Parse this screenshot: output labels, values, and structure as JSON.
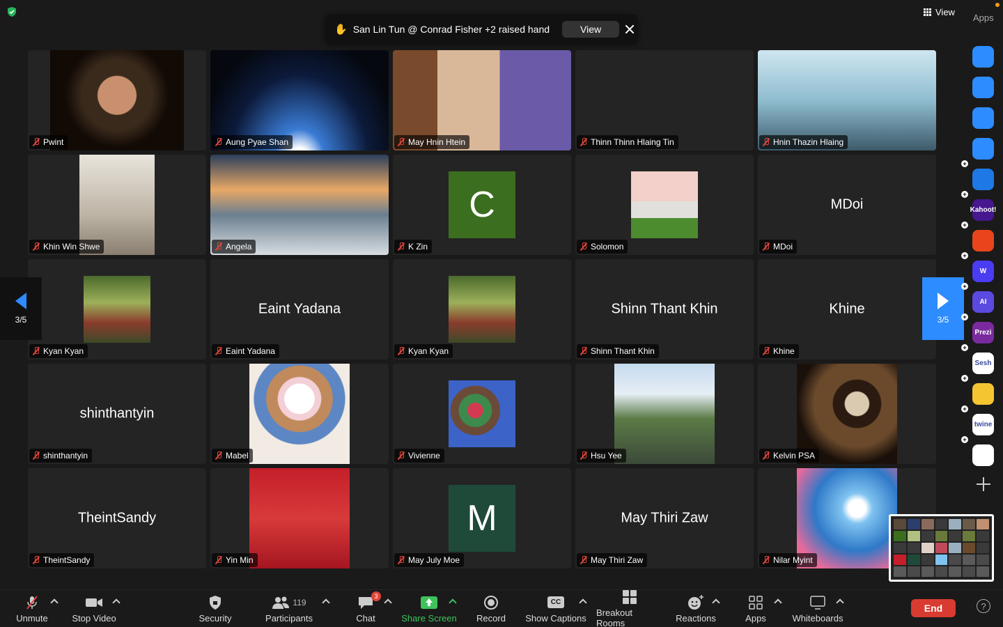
{
  "topbar": {
    "view_label": "View",
    "apps_title": "Apps"
  },
  "notification": {
    "message": "San Lin Tun @ Conrad Fisher +2 raised hand",
    "view_label": "View"
  },
  "pager": {
    "left_label": "3/5",
    "right_label": "3/5"
  },
  "participants": [
    {
      "name": "Pwint",
      "display": "video"
    },
    {
      "name": "Aung Pyae Shan",
      "display": "video"
    },
    {
      "name": "May Hnin Htein",
      "display": "video"
    },
    {
      "name": "Thinn Thinn Hlaing Tin",
      "display": "blank"
    },
    {
      "name": "Hnin Thazin Hlaing",
      "display": "video"
    },
    {
      "name": "Khin Win Shwe",
      "display": "video"
    },
    {
      "name": "Angela",
      "display": "video"
    },
    {
      "name": "K Zin",
      "display": "avatar-letter",
      "letter": "C",
      "color": "#3b6e1f"
    },
    {
      "name": "Solomon",
      "display": "photo"
    },
    {
      "name": "MDoi",
      "display": "name",
      "big_name": "MDoi"
    },
    {
      "name": "Kyan Kyan",
      "display": "photo"
    },
    {
      "name": "Eaint Yadana",
      "display": "name",
      "big_name": "Eaint Yadana"
    },
    {
      "name": "Kyan Kyan",
      "display": "photo"
    },
    {
      "name": "Shinn Thant Khin",
      "display": "name",
      "big_name": "Shinn Thant Khin"
    },
    {
      "name": "Khine",
      "display": "name",
      "big_name": "Khine"
    },
    {
      "name": "shinthantyin",
      "display": "name",
      "big_name": "shinthantyin"
    },
    {
      "name": "Mabel",
      "display": "photo"
    },
    {
      "name": "Vivienne",
      "display": "photo"
    },
    {
      "name": "Hsu Yee",
      "display": "photo"
    },
    {
      "name": "Kelvin PSA",
      "display": "photo"
    },
    {
      "name": "TheintSandy",
      "display": "name",
      "big_name": "TheintSandy"
    },
    {
      "name": "Yin Min",
      "display": "photo"
    },
    {
      "name": "May July Moe",
      "display": "avatar-letter",
      "letter": "M",
      "color": "#1f4a3a"
    },
    {
      "name": "May Thiri Zaw",
      "display": "name",
      "big_name": "May Thiri Zaw"
    },
    {
      "name": "Nilar Myint",
      "display": "photo"
    }
  ],
  "apps": [
    {
      "name": "camera-app-icon",
      "label": "",
      "color": "#2d8cff"
    },
    {
      "name": "music-app-icon",
      "label": "",
      "color": "#2d8cff"
    },
    {
      "name": "timer-app-icon",
      "label": "",
      "color": "#2d8cff"
    },
    {
      "name": "avatar-app-icon",
      "label": "",
      "color": "#2d8cff"
    },
    {
      "name": "pitch-app-icon",
      "label": "",
      "color": "#1e78e6"
    },
    {
      "name": "kahoot-app-icon",
      "label": "Kahoot!",
      "color": "#46178f"
    },
    {
      "name": "whiteboard-app-icon",
      "label": "",
      "color": "#e8451c"
    },
    {
      "name": "wooclap-app-icon",
      "label": "W",
      "color": "#4a3cf0"
    },
    {
      "name": "ai-app-icon",
      "label": "AI",
      "color": "#5b4ae0"
    },
    {
      "name": "prezi-app-icon",
      "label": "Prezi",
      "color": "#7a2a9e"
    },
    {
      "name": "sesh-app-icon",
      "label": "Sesh",
      "color": "#ffffff"
    },
    {
      "name": "emoji-app-icon",
      "label": "",
      "color": "#f5c531"
    },
    {
      "name": "twine-app-icon",
      "label": "twine",
      "color": "#ffffff"
    },
    {
      "name": "blocks-app-icon",
      "label": "",
      "color": "#ffffff"
    }
  ],
  "toolbar": {
    "unmute": "Unmute",
    "stop_video": "Stop Video",
    "security": "Security",
    "participants": "Participants",
    "participants_count": "119",
    "chat": "Chat",
    "chat_badge": "3",
    "share_screen": "Share Screen",
    "record": "Record",
    "show_captions": "Show Captions",
    "captions_icon": "CC",
    "breakout_rooms": "Breakout Rooms",
    "reactions": "Reactions",
    "apps": "Apps",
    "whiteboards": "Whiteboards",
    "end": "End",
    "help": "?"
  }
}
